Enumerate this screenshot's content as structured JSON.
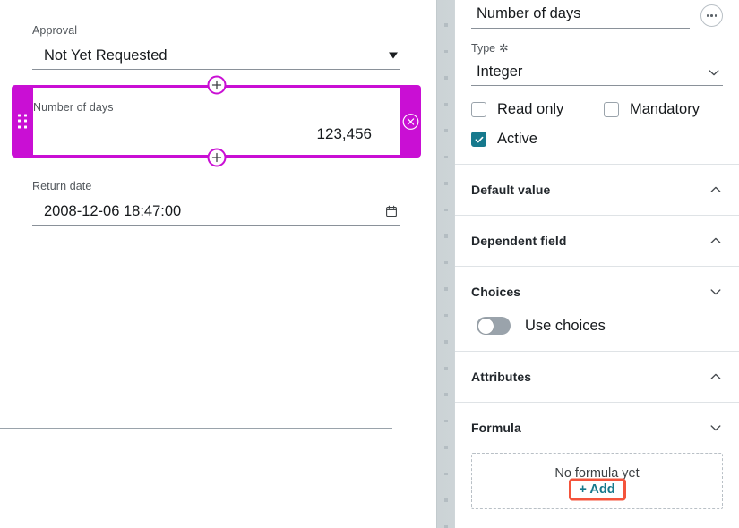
{
  "canvas": {
    "fields": [
      {
        "label": "Approval",
        "value": "Not Yet Requested",
        "control": "select"
      },
      {
        "label": "Return date",
        "value": "2008-12-06 18:47:00",
        "control": "datetime"
      }
    ],
    "selected_field": {
      "label": "Number of days",
      "value": "123,456",
      "highlight_color": "#c90fd4",
      "add_above_icon": "plus-icon",
      "add_below_icon": "plus-icon",
      "remove_icon": "close-circle-icon",
      "drag_icon": "drag-handle-icon"
    }
  },
  "panel": {
    "title": {
      "value": "Number of days",
      "menu_icon": "kebab-menu-icon"
    },
    "type": {
      "label": "Type",
      "required_mark": "✲",
      "value": "Integer",
      "chevron_icon": "chevron-down-icon"
    },
    "checkboxes": [
      {
        "label": "Read only",
        "checked": false
      },
      {
        "label": "Mandatory",
        "checked": false
      },
      {
        "label": "Active",
        "checked": true
      }
    ],
    "checkbox_accent": "#16798d",
    "sections": [
      {
        "title": "Default value",
        "chevron": "chevron-up-icon",
        "expanded": false
      },
      {
        "title": "Dependent field",
        "chevron": "chevron-up-icon",
        "expanded": false
      },
      {
        "title": "Choices",
        "chevron": "chevron-down-icon",
        "expanded": true
      },
      {
        "title": "Attributes",
        "chevron": "chevron-up-icon",
        "expanded": false
      },
      {
        "title": "Formula",
        "chevron": "chevron-down-icon",
        "expanded": true
      }
    ],
    "choices": {
      "toggle_label": "Use choices",
      "toggle_on": false
    },
    "formula": {
      "empty_text": "No formula yet",
      "add_label": "+ Add",
      "add_color": "#16798d",
      "annotation_color": "#f4543c"
    }
  }
}
